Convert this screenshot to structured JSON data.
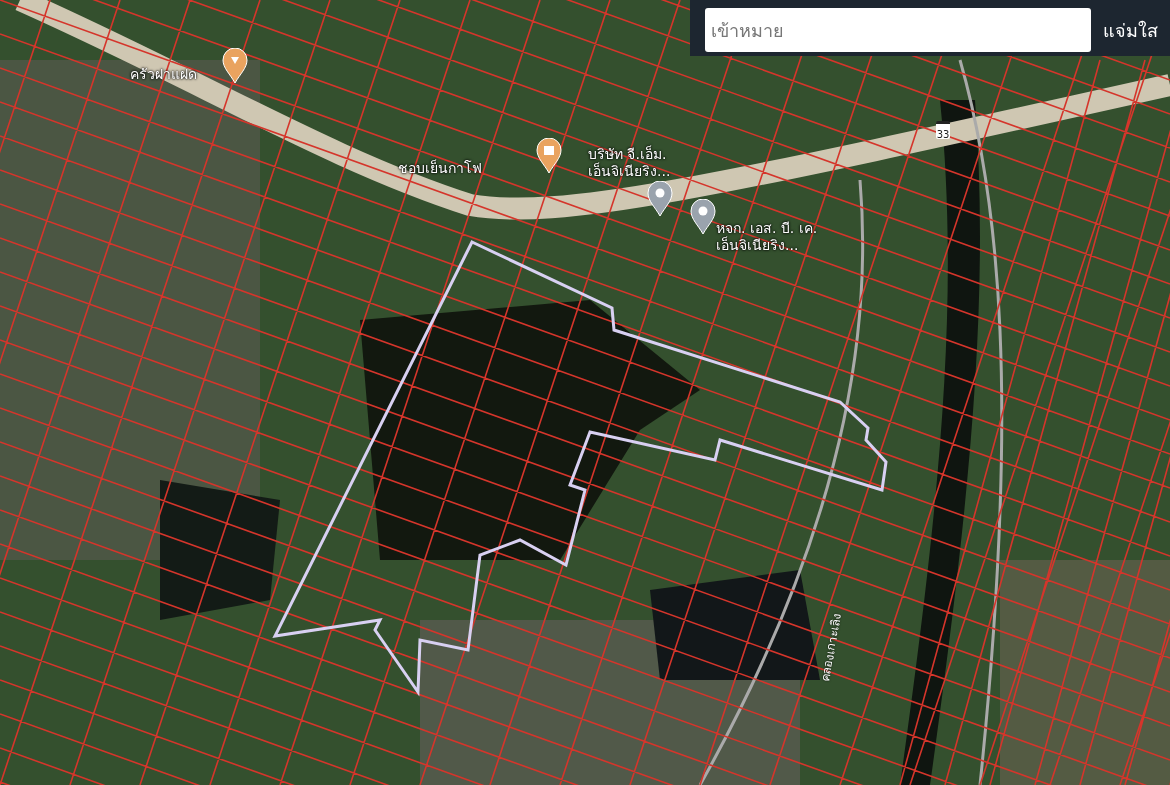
{
  "search": {
    "placeholder": "เข้าหมาย",
    "button": "แจ่มใส"
  },
  "places": [
    {
      "name": [
        "ครัวฝาแฝด"
      ],
      "kind": "restaurant"
    },
    {
      "name": [
        "ชอบเย็นกาโฟ"
      ],
      "kind": "cafe"
    },
    {
      "name": [
        "บริษัท จี.เอ็ม.",
        "เอ็นจิเนียริง..."
      ],
      "kind": "business"
    },
    {
      "name": [
        "หจก. เอส. บี. เค.",
        "เอ็นจิเนียริง..."
      ],
      "kind": "business"
    }
  ],
  "route_shield": "33",
  "canal_label": "คลองเกาะเลิง"
}
